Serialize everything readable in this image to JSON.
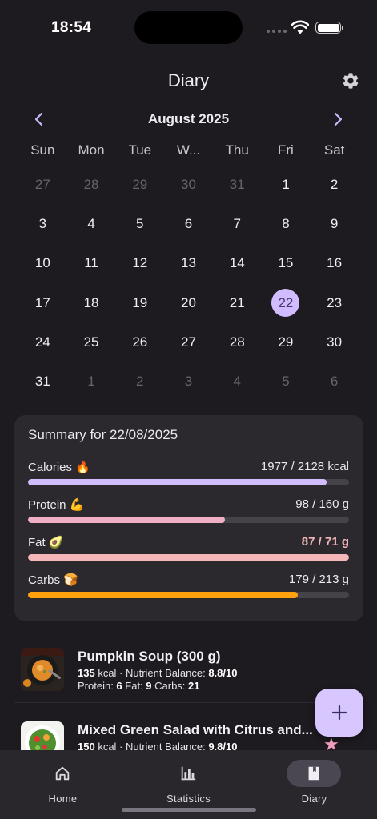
{
  "status_bar": {
    "time": "18:54"
  },
  "header": {
    "title": "Diary"
  },
  "calendar": {
    "month_label": "August 2025",
    "weekdays": [
      "Sun",
      "Mon",
      "Tue",
      "W...",
      "Thu",
      "Fri",
      "Sat"
    ],
    "days": [
      {
        "d": "27",
        "muted": true
      },
      {
        "d": "28",
        "muted": true
      },
      {
        "d": "29",
        "muted": true
      },
      {
        "d": "30",
        "muted": true
      },
      {
        "d": "31",
        "muted": true
      },
      {
        "d": "1"
      },
      {
        "d": "2"
      },
      {
        "d": "3"
      },
      {
        "d": "4"
      },
      {
        "d": "5"
      },
      {
        "d": "6"
      },
      {
        "d": "7"
      },
      {
        "d": "8"
      },
      {
        "d": "9"
      },
      {
        "d": "10"
      },
      {
        "d": "11"
      },
      {
        "d": "12"
      },
      {
        "d": "13"
      },
      {
        "d": "14"
      },
      {
        "d": "15"
      },
      {
        "d": "16"
      },
      {
        "d": "17"
      },
      {
        "d": "18"
      },
      {
        "d": "19"
      },
      {
        "d": "20"
      },
      {
        "d": "21"
      },
      {
        "d": "22",
        "selected": true
      },
      {
        "d": "23"
      },
      {
        "d": "24"
      },
      {
        "d": "25"
      },
      {
        "d": "26"
      },
      {
        "d": "27"
      },
      {
        "d": "28"
      },
      {
        "d": "29"
      },
      {
        "d": "30"
      },
      {
        "d": "31"
      },
      {
        "d": "1",
        "muted": true
      },
      {
        "d": "2",
        "muted": true
      },
      {
        "d": "3",
        "muted": true
      },
      {
        "d": "4",
        "muted": true
      },
      {
        "d": "5",
        "muted": true
      },
      {
        "d": "6",
        "muted": true
      }
    ]
  },
  "summary": {
    "title": "Summary for 22/08/2025",
    "rows": [
      {
        "label": "Calories 🔥",
        "value": "1977 / 2128 kcal",
        "progress": 0.929,
        "color": "#d0bcff",
        "over": false
      },
      {
        "label": "Protein 💪",
        "value": "98 / 160 g",
        "progress": 0.6125,
        "color": "#efb0c4",
        "over": false
      },
      {
        "label": "Fat 🥑",
        "value": "87 / 71 g",
        "progress": 1.0,
        "color": "#f4b6b6",
        "over": true
      },
      {
        "label": "Carbs 🍞",
        "value": "179 / 213 g",
        "progress": 0.84,
        "color": "#ffa20d",
        "over": false
      }
    ]
  },
  "meals": [
    {
      "name": "Pumpkin Soup (300 g)",
      "kcal": "135",
      "kcal_suffix": " kcal · Nutrient Balance: ",
      "balance": "8.8/10",
      "protein_label": "Protein: ",
      "protein": "6",
      "fat_label": " Fat: ",
      "fat": "9",
      "carbs_label": " Carbs: ",
      "carbs": "21"
    },
    {
      "name": "Mixed Green Salad with Citrus and...",
      "kcal": "150",
      "kcal_suffix": " kcal · Nutrient Balance: ",
      "balance": "9.8/10"
    }
  ],
  "nav": {
    "items": [
      {
        "label": "Home",
        "icon": "home-icon"
      },
      {
        "label": "Statistics",
        "icon": "bar-chart-icon"
      },
      {
        "label": "Diary",
        "icon": "book-icon",
        "active": true
      }
    ]
  },
  "colors": {
    "accent": "#d0bcff",
    "background": "#1d1b20",
    "card": "#2b292e"
  }
}
